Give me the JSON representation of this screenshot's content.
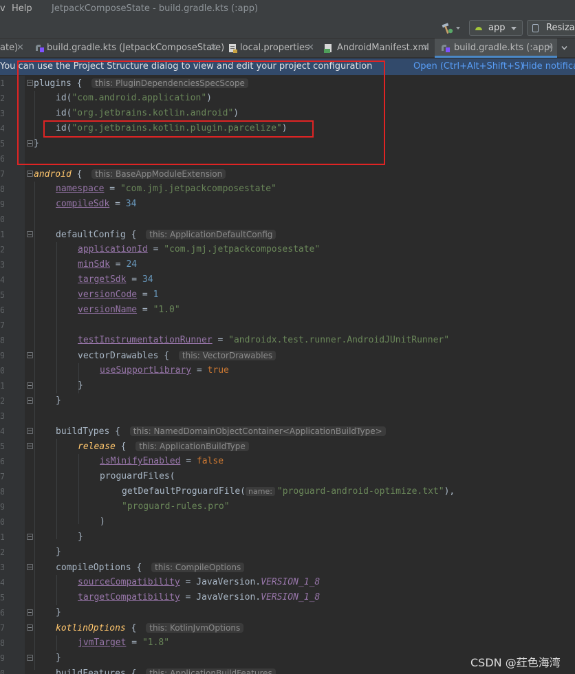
{
  "menu": {
    "items": [
      "v",
      "Help"
    ],
    "title": "JetpackComposeState - build.gradle.kts (:app)"
  },
  "toolbar": {
    "run_config": "app",
    "device": "Resizab"
  },
  "tabs": [
    {
      "label": "ate)",
      "icon": "none",
      "active": false
    },
    {
      "label": "build.gradle.kts (JetpackComposeState)",
      "icon": "gradle-kotlin-icon",
      "active": false
    },
    {
      "label": "local.properties",
      "icon": "properties-file-icon",
      "active": false
    },
    {
      "label": "AndroidManifest.xml",
      "icon": "manifest-file-icon",
      "active": false
    },
    {
      "label": "build.gradle.kts (:app)",
      "icon": "gradle-kotlin-icon",
      "active": true
    }
  ],
  "banner": {
    "message": "You can use the Project Structure dialog to view and edit your project configuration",
    "open_link": "Open (Ctrl+Alt+Shift+S)",
    "hide_link": "Hide notificat"
  },
  "line_numbers": [
    "1",
    "2",
    "3",
    "4",
    "5",
    "6",
    "7",
    "8",
    "9",
    "0",
    "1",
    "2",
    "3",
    "4",
    "5",
    "6",
    "7",
    "8",
    "9",
    "0",
    "1",
    "2",
    "3",
    "4",
    "5",
    "6",
    "7",
    "8",
    "9",
    "0",
    "1",
    "2",
    "3",
    "4",
    "5",
    "6",
    "7",
    "8",
    "9",
    "0",
    "1",
    "2",
    "3",
    "4"
  ],
  "code": {
    "plugins": "plugins",
    "plugins_hint": "this: PluginDependenciesSpecScope",
    "id_android_app": "\"com.android.application\"",
    "id_kotlin_android": "\"org.jetbrains.kotlin.android\"",
    "id_parcelize": "\"org.jetbrains.kotlin.plugin.parcelize\"",
    "android": "android",
    "android_hint": "this: BaseAppModuleExtension",
    "namespace": "namespace",
    "namespace_val": "\"com.jmj.jetpackcomposestate\"",
    "compileSdk": "compileSdk",
    "compileSdk_val": "34",
    "defaultConfig": "defaultConfig",
    "defaultConfig_hint": "this: ApplicationDefaultConfig",
    "applicationId": "applicationId",
    "applicationId_val": "\"com.jmj.jetpackcomposestate\"",
    "minSdk": "minSdk",
    "minSdk_val": "24",
    "targetSdk": "targetSdk",
    "targetSdk_val": "34",
    "versionCode": "versionCode",
    "versionCode_val": "1",
    "versionName": "versionName",
    "versionName_val": "\"1.0\"",
    "testRunner": "testInstrumentationRunner",
    "testRunner_val": "\"androidx.test.runner.AndroidJUnitRunner\"",
    "vectorDrawables": "vectorDrawables",
    "vectorDrawables_hint": "this: VectorDrawables",
    "useSupportLibrary": "useSupportLibrary",
    "true_val": "true",
    "buildTypes": "buildTypes",
    "buildTypes_hint": "this: NamedDomainObjectContainer<ApplicationBuildType>",
    "release": "release",
    "release_hint": "this: ApplicationBuildType",
    "isMinifyEnabled": "isMinifyEnabled",
    "false_val": "false",
    "proguardFiles": "proguardFiles(",
    "getDefaultProguardFile": "getDefaultProguardFile(",
    "name_hint": "name:",
    "proguard_optimize": "\"proguard-android-optimize.txt\"",
    "proguard_rules": "\"proguard-rules.pro\"",
    "compileOptions": "compileOptions",
    "compileOptions_hint": "this: CompileOptions",
    "sourceCompatibility": "sourceCompatibility",
    "targetCompatibility": "targetCompatibility",
    "javaVersion": "JavaVersion.",
    "version_1_8": "VERSION_1_8",
    "kotlinOptions": "kotlinOptions",
    "kotlinOptions_hint": "this: KotlinJvmOptions",
    "jvmTarget": "jvmTarget",
    "jvmTarget_val": "\"1.8\"",
    "buildFeatures": "buildFeatures",
    "buildFeatures_hint": "this: ApplicationBuildFeatures"
  },
  "watermark": "CSDN @荭色海湾",
  "colors": {
    "keyword": "#cc7832",
    "string": "#6a8759",
    "number": "#6897bb",
    "property": "#9876aa",
    "highlight_box": "#e02424",
    "banner_bg": "#324a6b",
    "link": "#589df6"
  }
}
